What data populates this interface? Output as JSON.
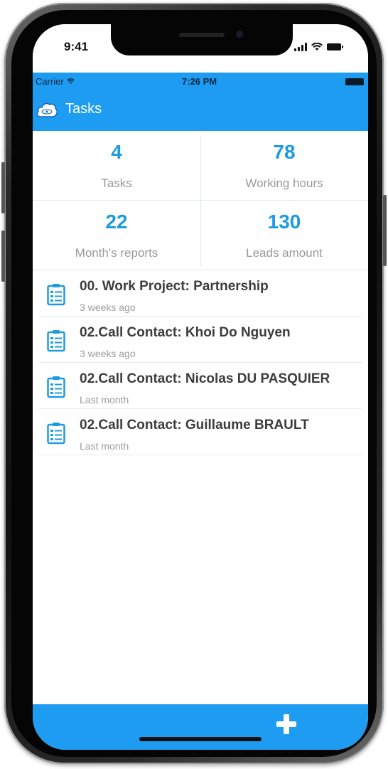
{
  "device": {
    "time": "9:41"
  },
  "app_status": {
    "carrier": "Carrier",
    "time": "7:26 PM"
  },
  "header": {
    "title": "Tasks",
    "logo_icon": "atomic-cloud-logo"
  },
  "stats": [
    {
      "value": "4",
      "label": "Tasks"
    },
    {
      "value": "78",
      "label": "Working hours"
    },
    {
      "value": "22",
      "label": "Month's reports"
    },
    {
      "value": "130",
      "label": "Leads amount"
    }
  ],
  "tasks": [
    {
      "title": "00. Work Project: Partnership",
      "time": "3 weeks ago",
      "icon": "task-list-icon"
    },
    {
      "title": "02.Call Contact: Khoi Do Nguyen",
      "time": "3 weeks ago",
      "icon": "task-list-icon"
    },
    {
      "title": "02.Call Contact: Nicolas DU PASQUIER",
      "time": "Last month",
      "icon": "task-list-icon"
    },
    {
      "title": "02.Call Contact: Guillaume BRAULT",
      "time": "Last month",
      "icon": "task-list-icon"
    }
  ],
  "bottom_bar": {
    "add_icon": "plus-icon"
  },
  "colors": {
    "primary": "#1e9cf1",
    "stat_value": "#1e9be0",
    "muted_text": "#9a9a9a"
  }
}
